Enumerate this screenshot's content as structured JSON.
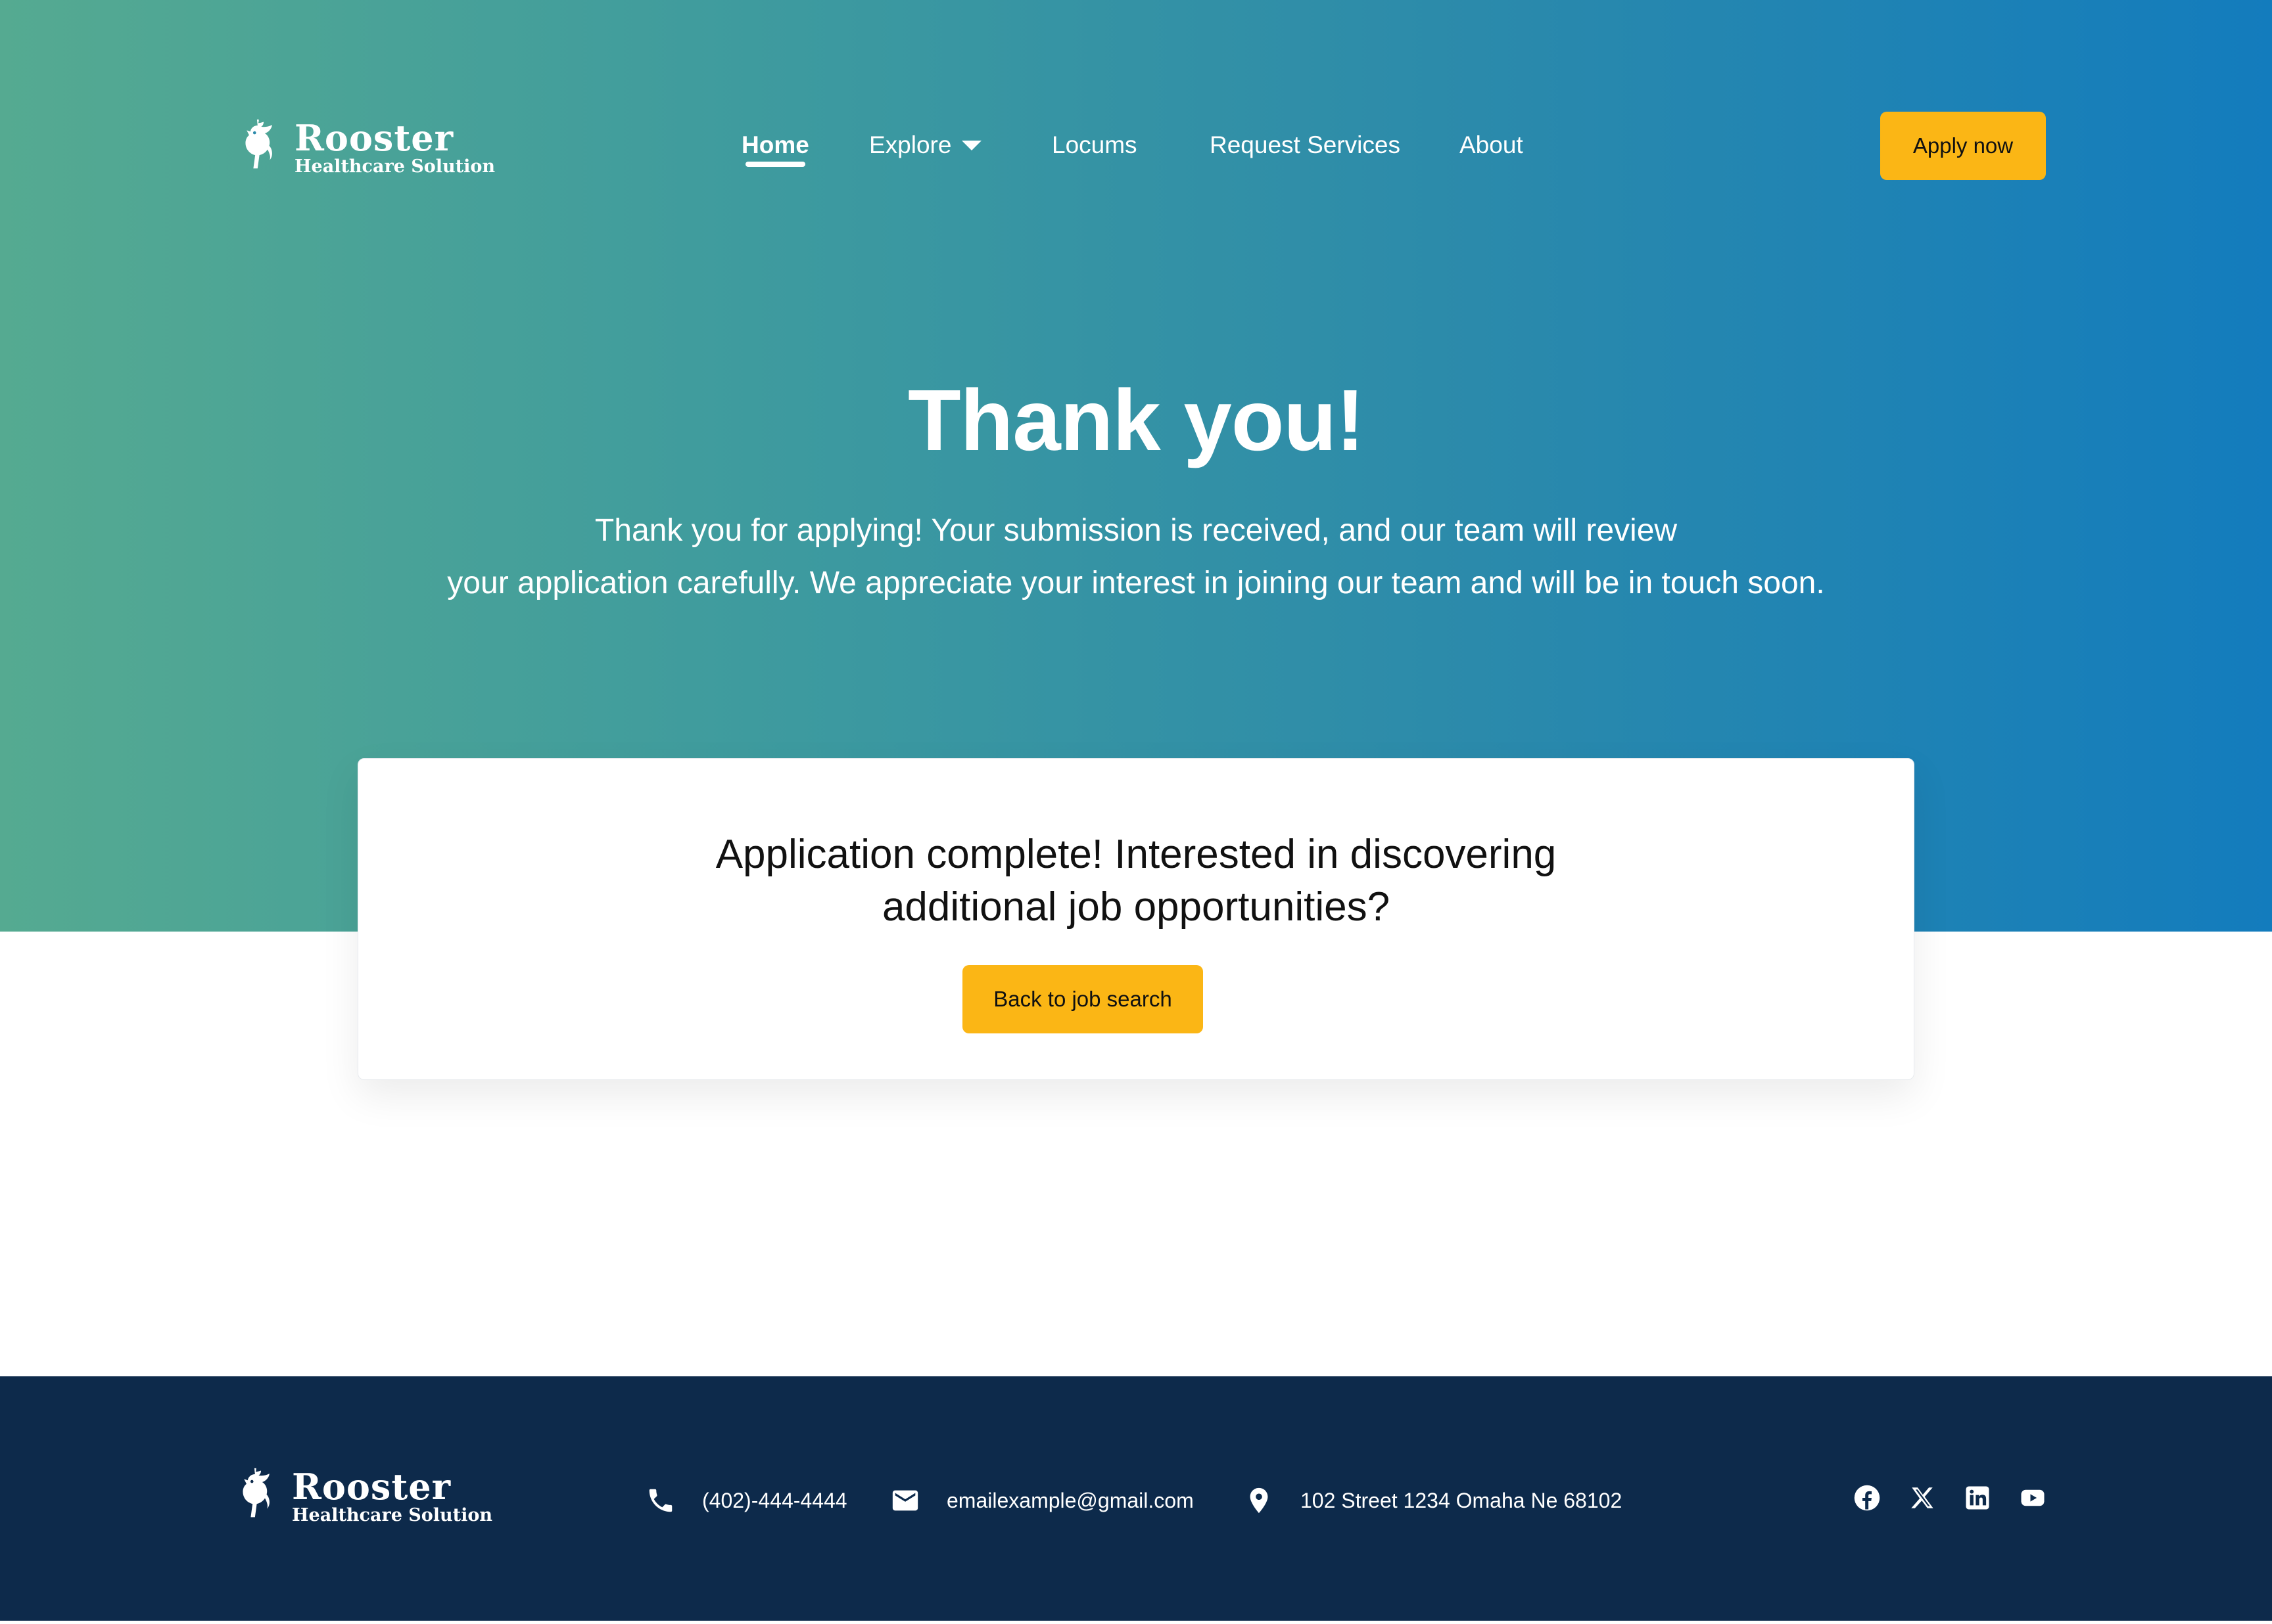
{
  "brand": {
    "name": "Rooster",
    "tagline": "Healthcare Solution"
  },
  "nav": {
    "items": [
      {
        "label": "Home",
        "active": true
      },
      {
        "label": "Explore",
        "has_dropdown": true
      },
      {
        "label": "Locums"
      },
      {
        "label": "Request Services"
      },
      {
        "label": "About"
      }
    ],
    "cta_label": "Apply now"
  },
  "hero": {
    "title": "Thank you!",
    "subtitle_line1": "Thank you for applying! Your submission is received, and our team will review",
    "subtitle_line2": "your application carefully. We appreciate your interest in joining our team and will be in touch soon."
  },
  "card": {
    "line1": "Application complete! Interested in discovering",
    "line2": "additional job opportunities?",
    "button_label": "Back to job search"
  },
  "footer": {
    "phone": "(402)-444-4444",
    "email": "emailexample@gmail.com",
    "address": "102 Street 1234 Omaha Ne 68102",
    "social_icons": [
      "facebook-icon",
      "x-icon",
      "linkedin-icon",
      "youtube-icon"
    ]
  },
  "colors": {
    "gradient_start": "#55aa91",
    "gradient_end": "#137cbd",
    "accent_yellow": "#fbb615",
    "footer_bg": "#0d2a4b",
    "text_white": "#ffffff"
  }
}
